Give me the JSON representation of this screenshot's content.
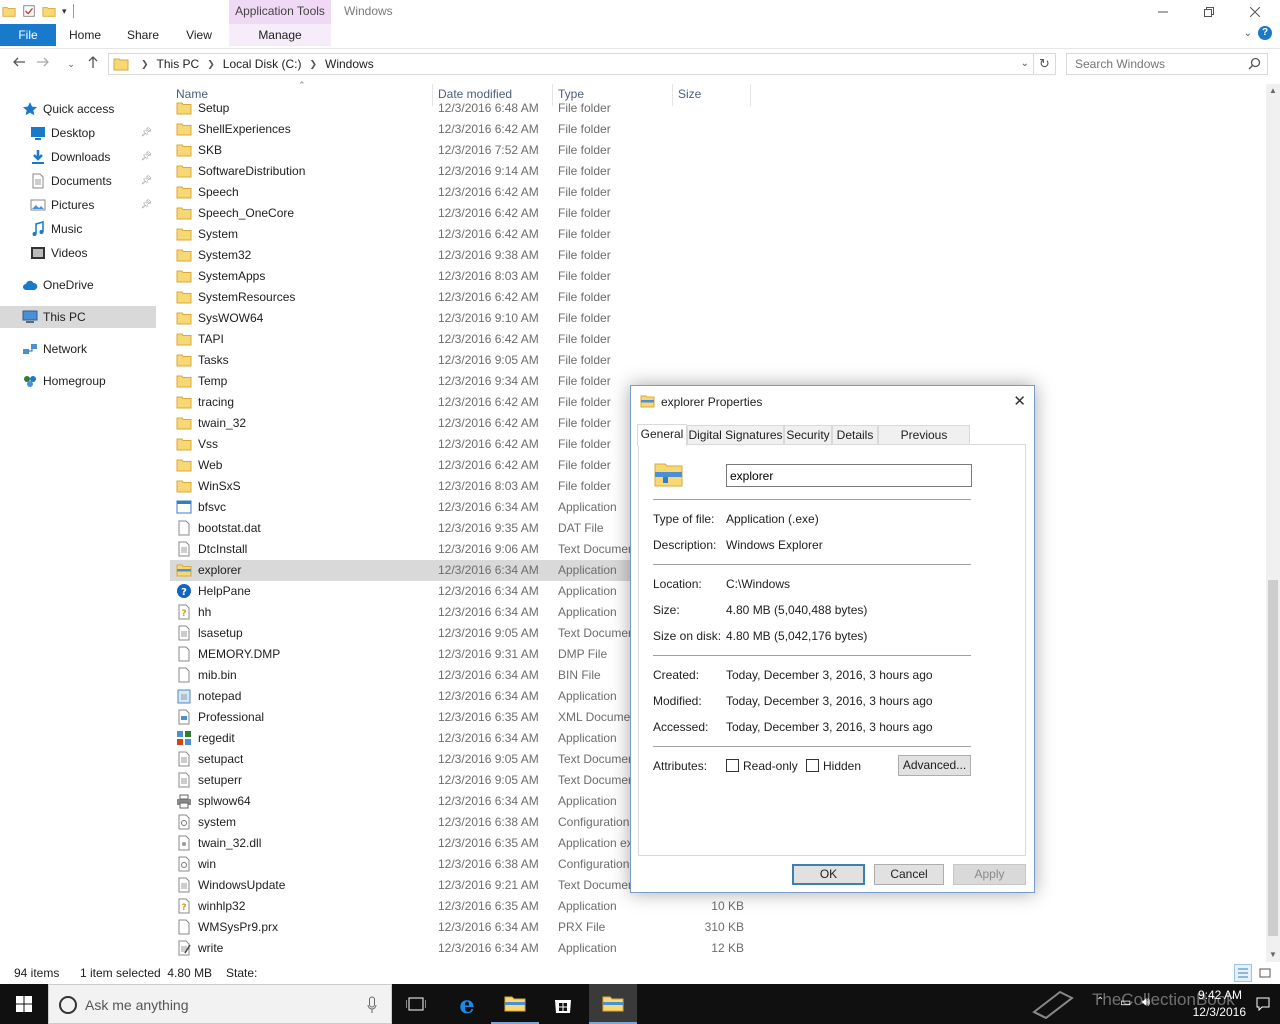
{
  "window": {
    "title": "Windows",
    "context_tab_group": "Application Tools"
  },
  "ribbon": {
    "tabs": [
      "File",
      "Home",
      "Share",
      "View",
      "Manage"
    ]
  },
  "address": {
    "crumbs": [
      "This PC",
      "Local Disk (C:)",
      "Windows"
    ],
    "search_placeholder": "Search Windows"
  },
  "nav": {
    "items": [
      {
        "label": "Quick access",
        "icon": "star-icon",
        "pinned": false
      },
      {
        "label": "Desktop",
        "icon": "desktop-icon",
        "pinned": true
      },
      {
        "label": "Downloads",
        "icon": "download-icon",
        "pinned": true
      },
      {
        "label": "Documents",
        "icon": "documents-icon",
        "pinned": true
      },
      {
        "label": "Pictures",
        "icon": "pictures-icon",
        "pinned": true
      },
      {
        "label": "Music",
        "icon": "music-icon",
        "pinned": false
      },
      {
        "label": "Videos",
        "icon": "videos-icon",
        "pinned": false
      },
      {
        "label": "OneDrive",
        "icon": "cloud-icon",
        "pinned": false
      },
      {
        "label": "This PC",
        "icon": "computer-icon",
        "pinned": false,
        "selected": true
      },
      {
        "label": "Network",
        "icon": "network-icon",
        "pinned": false
      },
      {
        "label": "Homegroup",
        "icon": "homegroup-icon",
        "pinned": false
      }
    ]
  },
  "columns": {
    "name": "Name",
    "date": "Date modified",
    "type": "Type",
    "size": "Size"
  },
  "files": [
    {
      "name": "Setup",
      "date": "12/3/2016 6:48 AM",
      "type": "File folder",
      "size": "",
      "icon": "folder-icon"
    },
    {
      "name": "ShellExperiences",
      "date": "12/3/2016 6:42 AM",
      "type": "File folder",
      "size": "",
      "icon": "folder-icon"
    },
    {
      "name": "SKB",
      "date": "12/3/2016 7:52 AM",
      "type": "File folder",
      "size": "",
      "icon": "folder-icon"
    },
    {
      "name": "SoftwareDistribution",
      "date": "12/3/2016 9:14 AM",
      "type": "File folder",
      "size": "",
      "icon": "folder-icon"
    },
    {
      "name": "Speech",
      "date": "12/3/2016 6:42 AM",
      "type": "File folder",
      "size": "",
      "icon": "folder-icon"
    },
    {
      "name": "Speech_OneCore",
      "date": "12/3/2016 6:42 AM",
      "type": "File folder",
      "size": "",
      "icon": "folder-icon"
    },
    {
      "name": "System",
      "date": "12/3/2016 6:42 AM",
      "type": "File folder",
      "size": "",
      "icon": "folder-icon"
    },
    {
      "name": "System32",
      "date": "12/3/2016 9:38 AM",
      "type": "File folder",
      "size": "",
      "icon": "folder-icon"
    },
    {
      "name": "SystemApps",
      "date": "12/3/2016 8:03 AM",
      "type": "File folder",
      "size": "",
      "icon": "folder-icon"
    },
    {
      "name": "SystemResources",
      "date": "12/3/2016 6:42 AM",
      "type": "File folder",
      "size": "",
      "icon": "folder-icon"
    },
    {
      "name": "SysWOW64",
      "date": "12/3/2016 9:10 AM",
      "type": "File folder",
      "size": "",
      "icon": "folder-icon"
    },
    {
      "name": "TAPI",
      "date": "12/3/2016 6:42 AM",
      "type": "File folder",
      "size": "",
      "icon": "folder-icon"
    },
    {
      "name": "Tasks",
      "date": "12/3/2016 9:05 AM",
      "type": "File folder",
      "size": "",
      "icon": "folder-icon"
    },
    {
      "name": "Temp",
      "date": "12/3/2016 9:34 AM",
      "type": "File folder",
      "size": "",
      "icon": "folder-icon"
    },
    {
      "name": "tracing",
      "date": "12/3/2016 6:42 AM",
      "type": "File folder",
      "size": "",
      "icon": "folder-icon"
    },
    {
      "name": "twain_32",
      "date": "12/3/2016 6:42 AM",
      "type": "File folder",
      "size": "",
      "icon": "folder-icon"
    },
    {
      "name": "Vss",
      "date": "12/3/2016 6:42 AM",
      "type": "File folder",
      "size": "",
      "icon": "folder-icon"
    },
    {
      "name": "Web",
      "date": "12/3/2016 6:42 AM",
      "type": "File folder",
      "size": "",
      "icon": "folder-icon"
    },
    {
      "name": "WinSxS",
      "date": "12/3/2016 8:03 AM",
      "type": "File folder",
      "size": "",
      "icon": "folder-icon"
    },
    {
      "name": "bfsvc",
      "date": "12/3/2016 6:34 AM",
      "type": "Application",
      "size": "",
      "icon": "app-icon"
    },
    {
      "name": "bootstat.dat",
      "date": "12/3/2016 9:35 AM",
      "type": "DAT File",
      "size": "",
      "icon": "file-icon"
    },
    {
      "name": "DtcInstall",
      "date": "12/3/2016 9:06 AM",
      "type": "Text Documen",
      "size": "",
      "icon": "text-file-icon"
    },
    {
      "name": "explorer",
      "date": "12/3/2016 6:34 AM",
      "type": "Application",
      "size": "",
      "icon": "explorer-icon",
      "selected": true
    },
    {
      "name": "HelpPane",
      "date": "12/3/2016 6:34 AM",
      "type": "Application",
      "size": "",
      "icon": "help-icon"
    },
    {
      "name": "hh",
      "date": "12/3/2016 6:34 AM",
      "type": "Application",
      "size": "",
      "icon": "help-doc-icon"
    },
    {
      "name": "lsasetup",
      "date": "12/3/2016 9:05 AM",
      "type": "Text Documen",
      "size": "",
      "icon": "text-file-icon"
    },
    {
      "name": "MEMORY.DMP",
      "date": "12/3/2016 9:31 AM",
      "type": "DMP File",
      "size": "",
      "icon": "file-icon"
    },
    {
      "name": "mib.bin",
      "date": "12/3/2016 6:34 AM",
      "type": "BIN File",
      "size": "",
      "icon": "file-icon"
    },
    {
      "name": "notepad",
      "date": "12/3/2016 6:34 AM",
      "type": "Application",
      "size": "",
      "icon": "notepad-icon"
    },
    {
      "name": "Professional",
      "date": "12/3/2016 6:35 AM",
      "type": "XML Docume",
      "size": "",
      "icon": "xml-file-icon"
    },
    {
      "name": "regedit",
      "date": "12/3/2016 6:34 AM",
      "type": "Application",
      "size": "",
      "icon": "regedit-icon"
    },
    {
      "name": "setupact",
      "date": "12/3/2016 9:05 AM",
      "type": "Text Documen",
      "size": "",
      "icon": "text-file-icon"
    },
    {
      "name": "setuperr",
      "date": "12/3/2016 9:05 AM",
      "type": "Text Documen",
      "size": "",
      "icon": "text-file-icon"
    },
    {
      "name": "splwow64",
      "date": "12/3/2016 6:34 AM",
      "type": "Application",
      "size": "",
      "icon": "printer-icon"
    },
    {
      "name": "system",
      "date": "12/3/2016 6:38 AM",
      "type": "Configuration",
      "size": "",
      "icon": "config-file-icon"
    },
    {
      "name": "twain_32.dll",
      "date": "12/3/2016 6:35 AM",
      "type": "Application ex",
      "size": "",
      "icon": "dll-file-icon"
    },
    {
      "name": "win",
      "date": "12/3/2016 6:38 AM",
      "type": "Configuration",
      "size": "",
      "icon": "config-file-icon"
    },
    {
      "name": "WindowsUpdate",
      "date": "12/3/2016 9:21 AM",
      "type": "Text Documen",
      "size": "",
      "icon": "text-file-icon"
    },
    {
      "name": "winhlp32",
      "date": "12/3/2016 6:35 AM",
      "type": "Application",
      "size": "10 KB",
      "icon": "help-doc-icon"
    },
    {
      "name": "WMSysPr9.prx",
      "date": "12/3/2016 6:34 AM",
      "type": "PRX File",
      "size": "310 KB",
      "icon": "file-icon"
    },
    {
      "name": "write",
      "date": "12/3/2016 6:34 AM",
      "type": "Application",
      "size": "12 KB",
      "icon": "write-icon"
    }
  ],
  "status": {
    "items_count": "94 items",
    "selected": "1 item selected  4.80 MB",
    "state_label": "State:"
  },
  "taskbar": {
    "search_placeholder": "Ask me anything",
    "time": "9:42 AM",
    "date": "12/3/2016",
    "watermark": "TheCollectionBook"
  },
  "dialog": {
    "title": "explorer Properties",
    "tabs": [
      "General",
      "Digital Signatures",
      "Security",
      "Details",
      "Previous Versions"
    ],
    "file_name": "explorer",
    "fields": [
      {
        "label": "Type of file:",
        "value": "Application (.exe)"
      },
      {
        "label": "Description:",
        "value": "Windows Explorer"
      },
      {
        "label": "Location:",
        "value": "C:\\Windows"
      },
      {
        "label": "Size:",
        "value": "4.80 MB (5,040,488 bytes)"
      },
      {
        "label": "Size on disk:",
        "value": "4.80 MB (5,042,176 bytes)"
      },
      {
        "label": "Created:",
        "value": "Today, December 3, 2016, 3 hours ago"
      },
      {
        "label": "Modified:",
        "value": "Today, December 3, 2016, 3 hours ago"
      },
      {
        "label": "Accessed:",
        "value": "Today, December 3, 2016, 3 hours ago"
      }
    ],
    "attributes_label": "Attributes:",
    "readonly_label": "Read-only",
    "hidden_label": "Hidden",
    "advanced_label": "Advanced...",
    "ok_label": "OK",
    "cancel_label": "Cancel",
    "apply_label": "Apply"
  },
  "colors": {
    "accent": "#1979ca",
    "folder": "#f8d775",
    "selection": "#d9d9d9"
  }
}
